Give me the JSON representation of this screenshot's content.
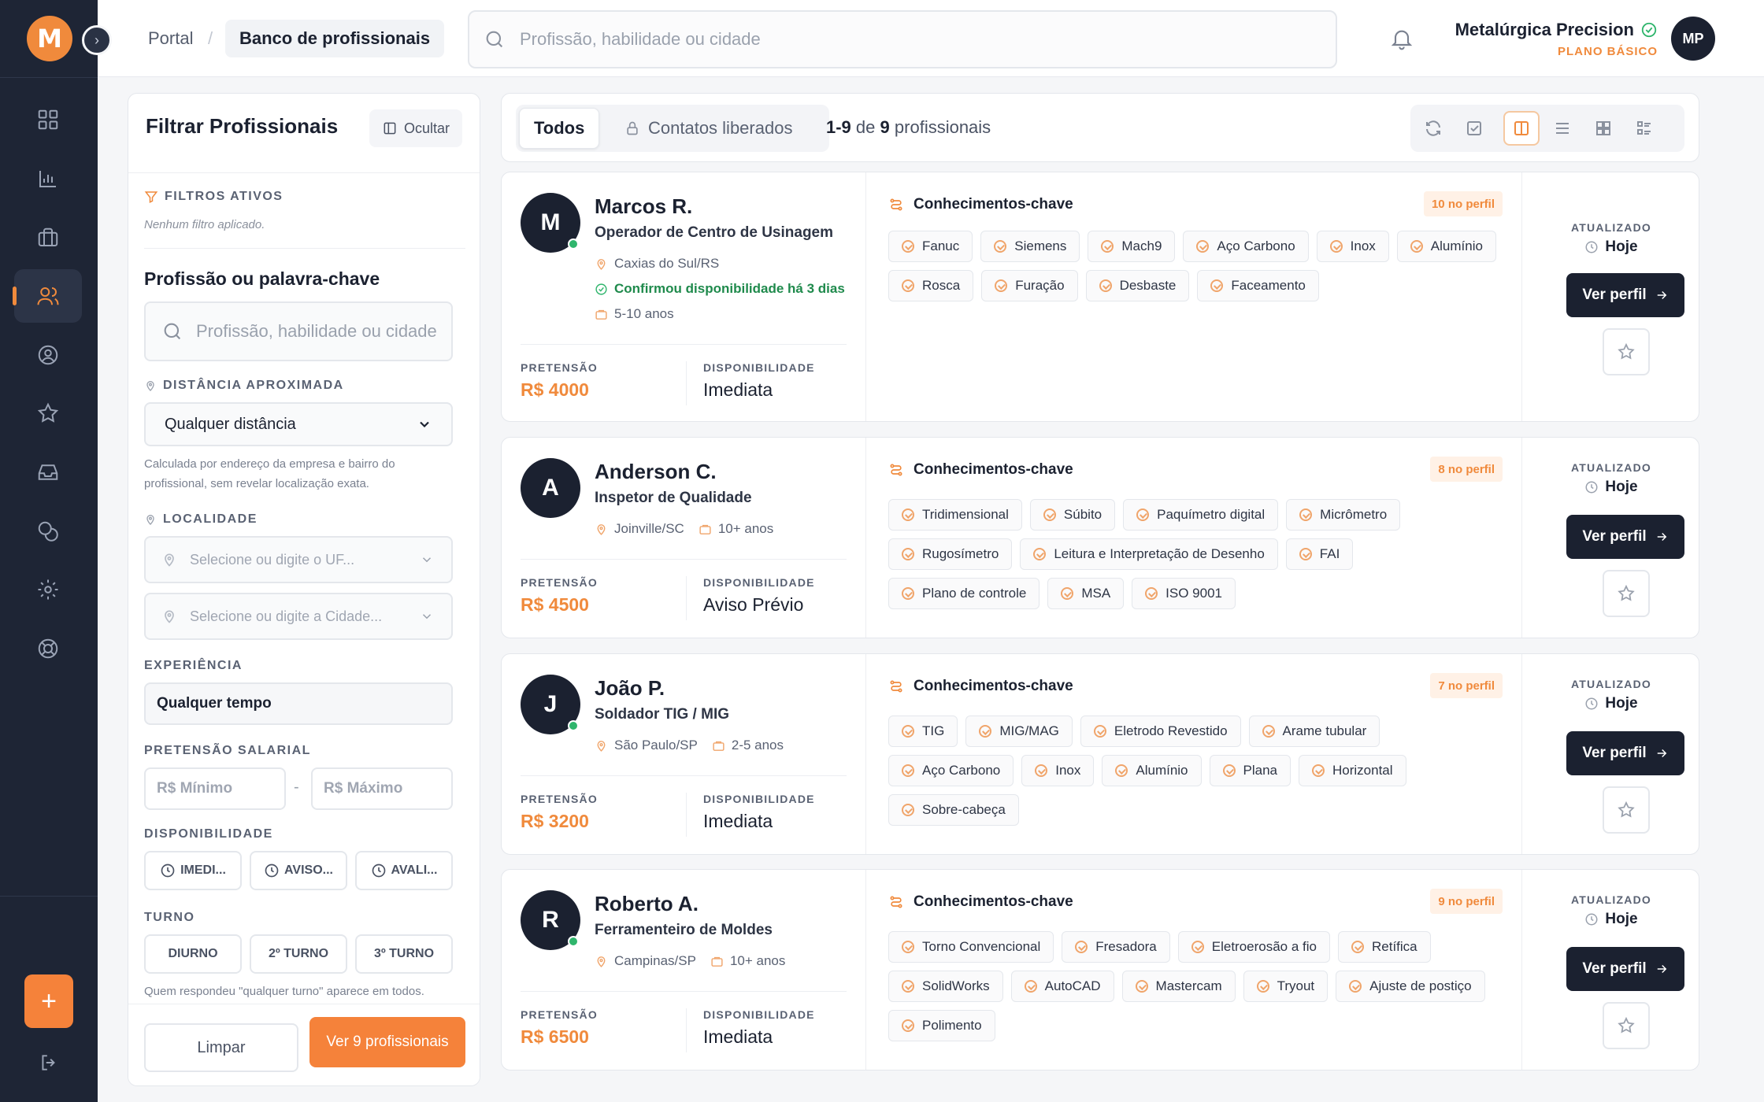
{
  "brand": {
    "logo_letter": "M",
    "accent": "#f08a3c",
    "dark": "#1e2535"
  },
  "breadcrumb": {
    "portal": "Portal",
    "current": "Banco de profissionais"
  },
  "search": {
    "placeholder": "Profissão, habilidade ou cidade"
  },
  "company": {
    "name": "Metalúrgica Precision",
    "plan": "PLANO BÁSICO",
    "initials": "MP"
  },
  "sidebar": {
    "icons": [
      "dashboard-icon",
      "chart-icon",
      "briefcase-icon",
      "users-icon",
      "user-circle-icon",
      "star-icon",
      "inbox-icon",
      "coins-icon",
      "gear-icon",
      "lifebuoy-icon"
    ],
    "active": "users-icon",
    "add_label": "+"
  },
  "filters": {
    "title": "Filtrar Profissionais",
    "hide_label": "Ocultar",
    "active_label": "FILTROS ATIVOS",
    "active_note": "Nenhum filtro aplicado.",
    "keyword_heading": "Profissão ou palavra-chave",
    "keyword_placeholder": "Profissão, habilidade ou cidade",
    "distance_label": "DISTÂNCIA APROXIMADA",
    "distance_value": "Qualquer distância",
    "distance_note_1": "Calculada por endereço da empresa e bairro do",
    "distance_note_2": "profissional, sem revelar localização exata.",
    "location_label": "LOCALIDADE",
    "uf_placeholder": "Selecione ou digite o UF...",
    "city_placeholder": "Selecione ou digite a Cidade...",
    "experience_label": "EXPERIÊNCIA",
    "experience_value": "Qualquer tempo",
    "salary_label": "PRETENSÃO SALARIAL",
    "salary_min": "R$ Mínimo",
    "salary_dash": "-",
    "salary_max": "R$ Máximo",
    "availability_label": "DISPONIBILIDADE",
    "availability_options": [
      "IMEDI...",
      "AVISO...",
      "AVALI..."
    ],
    "shift_label": "TURNO",
    "shift_options": [
      "DIURNO",
      "2º TURNO",
      "3º TURNO"
    ],
    "shift_note": "Quem respondeu \"qualquer turno\" aparece em todos.",
    "clear_label": "Limpar",
    "apply_label": "Ver 9 profissionais"
  },
  "toolbar": {
    "tab_all": "Todos",
    "tab_contacts": "Contatos liberados",
    "range": "1-9",
    "of": "de",
    "total": "9",
    "unit": "profissionais"
  },
  "card_labels": {
    "skills_title": "Conhecimentos-chave",
    "salary_label": "PRETENSÃO",
    "availability_label": "DISPONIBILIDADE",
    "updated_label": "ATUALIZADO",
    "view_label": "Ver perfil"
  },
  "candidates": [
    {
      "initial": "M",
      "name": "Marcos R.",
      "role": "Operador de Centro de Usinagem",
      "city": "Caxias do Sul/RS",
      "confirmed": "Confirmou disponibilidade há 3 dias",
      "experience": "5-10 anos",
      "salary": "R$ 4000",
      "availability": "Imediata",
      "skills_count": "10 no perfil",
      "updated": "Hoje",
      "skills": [
        "Fanuc",
        "Siemens",
        "Mach9",
        "Aço Carbono",
        "Inox",
        "Alumínio",
        "Rosca",
        "Furação",
        "Desbaste",
        "Faceamento"
      ]
    },
    {
      "initial": "A",
      "name": "Anderson C.",
      "role": "Inspetor de Qualidade",
      "city": "Joinville/SC",
      "experience": "10+ anos",
      "salary": "R$ 4500",
      "availability": "Aviso Prévio",
      "skills_count": "8 no perfil",
      "updated": "Hoje",
      "skills": [
        "Tridimensional",
        "Súbito",
        "Paquímetro digital",
        "Micrômetro",
        "Rugosímetro",
        "Leitura e Interpretação de Desenho",
        "FAI",
        "Plano de controle",
        "MSA",
        "ISO 9001"
      ]
    },
    {
      "initial": "J",
      "name": "João P.",
      "role": "Soldador TIG / MIG",
      "city": "São Paulo/SP",
      "experience": "2-5 anos",
      "salary": "R$ 3200",
      "availability": "Imediata",
      "skills_count": "7 no perfil",
      "updated": "Hoje",
      "skills": [
        "TIG",
        "MIG/MAG",
        "Eletrodo Revestido",
        "Arame tubular",
        "Aço Carbono",
        "Inox",
        "Alumínio",
        "Plana",
        "Horizontal",
        "Sobre-cabeça"
      ]
    },
    {
      "initial": "R",
      "name": "Roberto A.",
      "role": "Ferramenteiro de Moldes",
      "city": "Campinas/SP",
      "experience": "10+ anos",
      "salary": "R$ 6500",
      "availability": "Imediata",
      "skills_count": "9 no perfil",
      "updated": "Hoje",
      "skills": [
        "Torno Convencional",
        "Fresadora",
        "Eletroerosão a fio",
        "Retífica",
        "SolidWorks",
        "AutoCAD",
        "Mastercam",
        "Tryout",
        "Ajuste de postiço",
        "Polimento"
      ]
    }
  ]
}
